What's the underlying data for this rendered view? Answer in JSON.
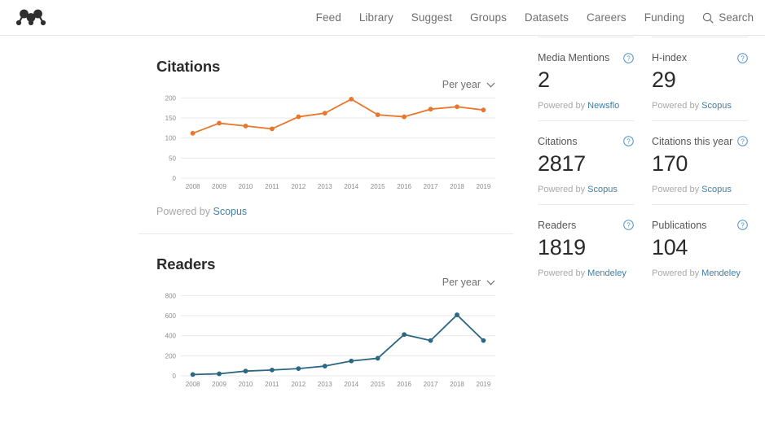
{
  "header": {
    "logo_name": "mendeley-logo",
    "nav": [
      {
        "label": "Feed",
        "name": "nav-feed"
      },
      {
        "label": "Library",
        "name": "nav-library"
      },
      {
        "label": "Suggest",
        "name": "nav-suggest"
      },
      {
        "label": "Groups",
        "name": "nav-groups"
      },
      {
        "label": "Datasets",
        "name": "nav-datasets"
      },
      {
        "label": "Careers",
        "name": "nav-careers"
      },
      {
        "label": "Funding",
        "name": "nav-funding"
      }
    ],
    "search_label": "Search",
    "search_icon": "search-icon"
  },
  "sections": {
    "citations": {
      "title": "Citations",
      "range_label": "Per year",
      "range_icon": "chevron-down-icon",
      "powered_prefix": "Powered by ",
      "powered_source": "Scopus"
    },
    "readers": {
      "title": "Readers",
      "range_label": "Per year",
      "range_icon": "chevron-down-icon"
    }
  },
  "sidebar": {
    "stats": [
      {
        "label": "Media Mentions",
        "value": "2",
        "powered_prefix": "Powered by ",
        "powered_source": "Newsflo",
        "info_icon": "info-icon",
        "name": "stat-media-mentions"
      },
      {
        "label": "H-index",
        "value": "29",
        "powered_prefix": "Powered by ",
        "powered_source": "Scopus",
        "info_icon": "info-icon",
        "name": "stat-h-index"
      },
      {
        "label": "Citations",
        "value": "2817",
        "powered_prefix": "Powered by ",
        "powered_source": "Scopus",
        "info_icon": "info-icon",
        "name": "stat-citations"
      },
      {
        "label": "Citations this year",
        "value": "170",
        "powered_prefix": "Powered by ",
        "powered_source": "Scopus",
        "info_icon": "info-icon",
        "name": "stat-citations-this-year"
      },
      {
        "label": "Readers",
        "value": "1819",
        "powered_prefix": "Powered by ",
        "powered_source": "Mendeley",
        "info_icon": "info-icon",
        "name": "stat-readers"
      },
      {
        "label": "Publications",
        "value": "104",
        "powered_prefix": "Powered by ",
        "powered_source": "Mendeley",
        "info_icon": "info-icon",
        "name": "stat-publications"
      }
    ]
  },
  "colors": {
    "citations_line": "#e8762c",
    "readers_line": "#2a6782",
    "link": "#3d7fa6",
    "muted": "#a8a8a8",
    "grid": "#e9e9e9"
  },
  "chart_data": [
    {
      "type": "line",
      "name": "citations-chart",
      "title": "Citations",
      "xlabel": "",
      "ylabel": "",
      "x": [
        "2008",
        "2009",
        "2010",
        "2011",
        "2012",
        "2013",
        "2014",
        "2015",
        "2016",
        "2017",
        "2018",
        "2019"
      ],
      "values": [
        112,
        137,
        130,
        123,
        153,
        162,
        197,
        158,
        153,
        172,
        178,
        170
      ],
      "yticks": [
        0,
        50,
        100,
        150,
        200
      ],
      "ylim": [
        0,
        215
      ],
      "color": "#e8762c",
      "grid": true,
      "legend": "none",
      "range_selector": "Per year",
      "source": "Scopus"
    },
    {
      "type": "line",
      "name": "readers-chart",
      "title": "Readers",
      "xlabel": "",
      "ylabel": "",
      "x": [
        "2008",
        "2009",
        "2010",
        "2011",
        "2012",
        "2013",
        "2014",
        "2015",
        "2016",
        "2017",
        "2018",
        "2019"
      ],
      "values": [
        13,
        20,
        47,
        58,
        72,
        97,
        148,
        175,
        412,
        352,
        608,
        352
      ],
      "yticks": [
        0,
        200,
        400,
        600,
        800
      ],
      "ylim": [
        0,
        860
      ],
      "color": "#2a6782",
      "grid": true,
      "legend": "none",
      "range_selector": "Per year",
      "source": "Mendeley"
    }
  ]
}
